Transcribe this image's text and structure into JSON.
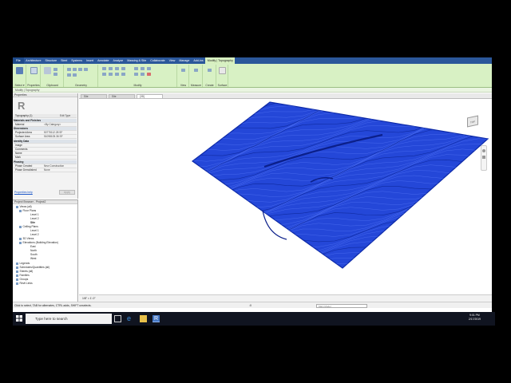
{
  "ribbon": {
    "tabs": [
      "File",
      "Architecture",
      "Structure",
      "Steel",
      "Systems",
      "Insert",
      "Annotate",
      "Analyze",
      "Massing & Site",
      "Collaborate",
      "View",
      "Manage",
      "Add-Ins",
      "Modify | Topography"
    ],
    "groups": [
      "Select",
      "Properties",
      "Clipboard",
      "Geometry",
      "Modify",
      "View",
      "Measure",
      "Create",
      "Surface"
    ],
    "select_label": "Select ▾",
    "context_label": "Modify | Topography"
  },
  "properties": {
    "title": "Properties",
    "type_selector": "Topography (1)",
    "edit_type": "Edit Type",
    "sections": {
      "materials": "Materials and Finishes",
      "dimensions": "Dimensions",
      "identity": "Identity Data",
      "phasing": "Phasing"
    },
    "rows": {
      "material_k": "Material",
      "material_v": "<By Category>",
      "proj_area_k": "Projected Area",
      "proj_area_v": "50775112.28 SF",
      "surf_area_k": "Surface Area",
      "surf_area_v": "51098105.36 SF",
      "image_k": "Image",
      "comments_k": "Comments",
      "name_k": "Name",
      "mark_k": "Mark",
      "phase_created_k": "Phase Created",
      "phase_created_v": "New Construction",
      "phase_demolished_k": "Phase Demolished",
      "phase_demolished_v": "None"
    },
    "help_link": "Properties help",
    "apply": "Apply"
  },
  "browser": {
    "title": "Project Browser - Project2",
    "nodes": [
      "Views (all)",
      "Floor Plans",
      "Level 1",
      "Level 2",
      "Site",
      "Ceiling Plans",
      "Level 1",
      "Level 2",
      "3D Views",
      "Elevations (Building Elevation)",
      "East",
      "North",
      "South",
      "West",
      "Legends",
      "Schedules/Quantities (all)",
      "Sheets (all)",
      "Families",
      "Groups",
      "Revit Links"
    ]
  },
  "viewtabs": [
    "Site",
    "Site",
    "{3D}"
  ],
  "viewcube": "TOP",
  "viewctl": "1/8\" = 1'-0\"",
  "status": {
    "hint": "Click to select, TAB for alternates, CTRL adds, SHIFT unselects.",
    "model": "Main Model",
    "zero": ":0"
  },
  "taskbar": {
    "search_placeholder": "Type here to search",
    "time": "9:01 PM",
    "date": "2/17/2019"
  },
  "colors": {
    "ribbon_blue": "#2b579a",
    "ribbon_green": "#d8f1c4",
    "terrain": "#1a3fd4"
  }
}
